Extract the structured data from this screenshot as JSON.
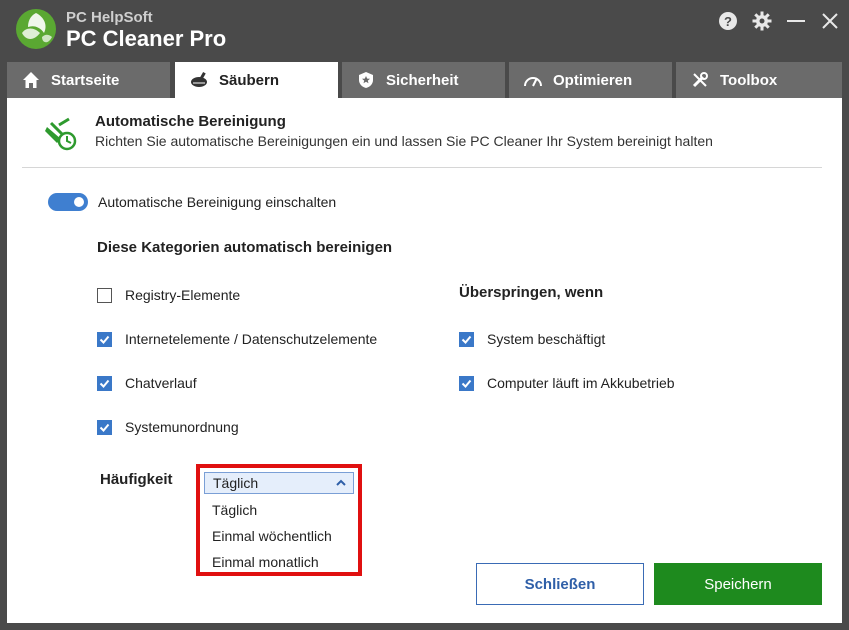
{
  "app": {
    "brand_small": "PC HelpSoft",
    "brand_big": "PC Cleaner Pro"
  },
  "window_controls": [
    "help-icon",
    "gear-icon",
    "minimize-icon",
    "close-icon"
  ],
  "tabs": [
    {
      "label": "Startseite",
      "icon": "home-icon"
    },
    {
      "label": "Säubern",
      "icon": "broom-icon"
    },
    {
      "label": "Sicherheit",
      "icon": "shield-icon"
    },
    {
      "label": "Optimieren",
      "icon": "gauge-icon"
    },
    {
      "label": "Toolbox",
      "icon": "tools-icon"
    }
  ],
  "header": {
    "title": "Automatische Bereinigung",
    "subtitle": "Richten Sie automatische Bereinigungen ein und lassen Sie PC Cleaner Ihr System bereinigt halten"
  },
  "toggle": {
    "label": "Automatische Bereinigung einschalten",
    "on": true
  },
  "categories": {
    "title": "Diese Kategorien automatisch bereinigen",
    "items": [
      {
        "label": "Registry-Elemente",
        "checked": false
      },
      {
        "label": "Internetelemente / Datenschutzelemente",
        "checked": true
      },
      {
        "label": "Chatverlauf",
        "checked": true
      },
      {
        "label": "Systemunordnung",
        "checked": true
      }
    ]
  },
  "skip": {
    "title": "Überspringen, wenn",
    "items": [
      {
        "label": "System beschäftigt",
        "checked": true
      },
      {
        "label": "Computer läuft im Akkubetrieb",
        "checked": true
      }
    ]
  },
  "frequency": {
    "label": "Häufigkeit",
    "selected": "Täglich",
    "options": [
      "Täglich",
      "Einmal wöchentlich",
      "Einmal monatlich"
    ]
  },
  "buttons": {
    "close": "Schließen",
    "save": "Speichern"
  },
  "colors": {
    "accent": "#3a78c8",
    "save": "#1e8a1e",
    "highlight": "#e01010"
  }
}
